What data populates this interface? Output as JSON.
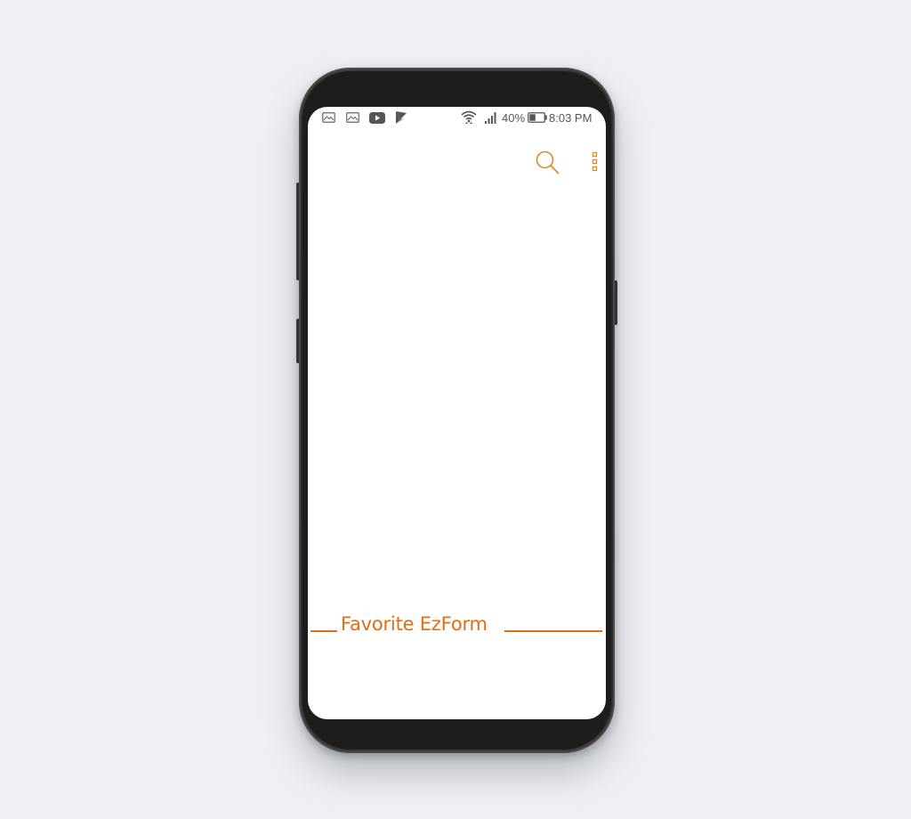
{
  "status_bar": {
    "battery_percent": "40%",
    "time": "8:03 PM",
    "icons": [
      "image-icon",
      "image-icon",
      "youtube-icon",
      "play-store-icon",
      "wifi-icon",
      "signal-icon",
      "battery-icon"
    ]
  },
  "toolbar": {
    "icons": [
      "search-icon",
      "more-vert-icon"
    ],
    "accent": "#e06d14"
  },
  "favorites": {
    "title": "Favorite EzForm"
  },
  "colors": {
    "accent": "#e06d14",
    "background": "#eef0f4",
    "screen": "#ffffff",
    "status_text": "#555555"
  }
}
